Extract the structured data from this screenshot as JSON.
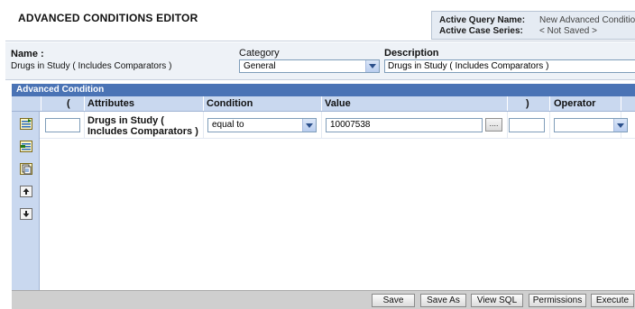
{
  "header": {
    "title": "ADVANCED CONDITIONS EDITOR",
    "active_query_label": "Active Query Name:",
    "active_query_value": "New Advanced Condition",
    "active_case_label": "Active Case Series:",
    "active_case_value": "< Not Saved >"
  },
  "meta": {
    "name_label": "Name :",
    "name_value": "Drugs in Study ( Includes Comparators )",
    "category_label": "Category",
    "category_value": "General",
    "description_label": "Description",
    "description_value": "Drugs in Study ( Includes Comparators )"
  },
  "panel": {
    "title": "Advanced Condition",
    "columns": {
      "open_paren": "(",
      "attributes": "Attributes",
      "condition": "Condition",
      "value": "Value",
      "close_paren": ")",
      "operator": "Operator"
    },
    "rows": [
      {
        "open_paren": "",
        "attribute": "Drugs in Study ( Includes Comparators )",
        "condition": "equal to",
        "value": "10007538",
        "value_button": "....",
        "close_paren": "",
        "operator": ""
      }
    ]
  },
  "rail_icons": [
    "add-row-icon",
    "insert-row-icon",
    "copy-row-icon",
    "move-up-icon",
    "move-down-icon"
  ],
  "footer": {
    "save": "Save",
    "save_as": "Save As",
    "view_sql": "View SQL",
    "permissions": "Permissions",
    "execute": "Execute"
  },
  "colors": {
    "panel_header": "#4a73b5",
    "column_header": "#c9d8ef",
    "query_box": "#e5ebf3"
  }
}
